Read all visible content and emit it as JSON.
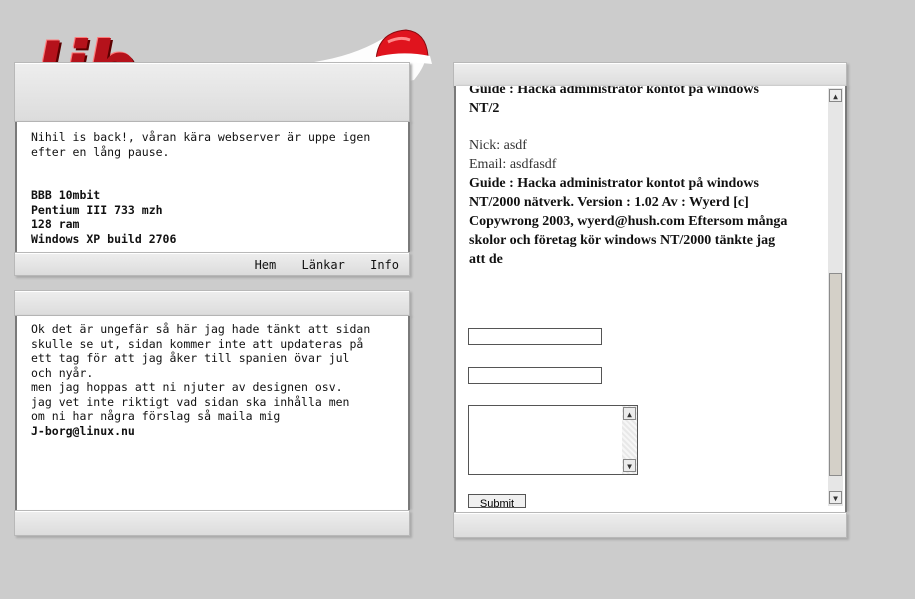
{
  "logo": {
    "text": "!jb"
  },
  "news": {
    "intro_line1": "Nihil is back!, våran kära webserver är uppe igen",
    "intro_line2": "efter en lång pause.",
    "specs": [
      "BBB 10mbit",
      "Pentium III 733 mzh",
      "128 ram",
      "Windows XP build 2706"
    ]
  },
  "nav": {
    "home": "Hem",
    "links": "Länkar",
    "info": "Info"
  },
  "message": {
    "lines": [
      "Ok det är ungefär så här jag hade tänkt att sidan",
      "skulle se ut, sidan kommer inte att updateras på",
      "ett tag för att jag åker till spanien övar jul",
      "och nyår.",
      "men jag hoppas att ni njuter av designen osv.",
      "jag vet inte riktigt vad sidan ska inhålla men",
      "om ni har några förslag så maila mig"
    ],
    "email": "J-borg@linux.nu"
  },
  "guestbook": {
    "entry1_title_cut": "Guide : Hacka administrator kontot på windows",
    "entry1_title_line2": "NT/2",
    "nick": "Nick: asdf",
    "email": "Email: asdfasdf",
    "entry2_lines": [
      "Guide : Hacka administrator kontot på windows",
      "NT/2000 nätverk. Version : 1.02 Av : Wyerd [c]",
      "Copywrong 2003, wyerd@hush.com Eftersom många",
      "skolor och företag kör windows NT/2000 tänkte jag",
      "att de"
    ],
    "field1_value": "",
    "field2_value": "",
    "textarea_value": "",
    "submit_label": "Submit"
  },
  "colors": {
    "logo_red": "#b5121b",
    "background": "#cccccc",
    "hat_red": "#e0141e"
  }
}
